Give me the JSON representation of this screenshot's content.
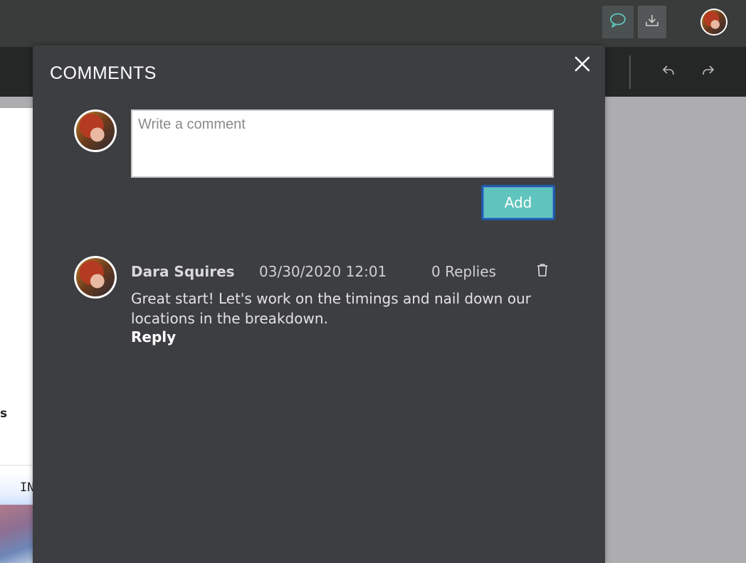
{
  "topbar": {
    "comments_icon": "speech-bubble-icon",
    "download_icon": "download-icon",
    "accent_color": "#5fc4bd"
  },
  "toolbar": {
    "undo_icon": "undo-icon",
    "redo_icon": "redo-icon"
  },
  "document": {
    "fragment_right_letter": "s",
    "fragment_bottom": "IN"
  },
  "comments_panel": {
    "title": "COMMENTS",
    "close_icon": "close-icon",
    "input": {
      "placeholder": "Write a comment",
      "value": ""
    },
    "add_label": "Add",
    "comments": [
      {
        "author": "Dara Squires",
        "date": "03/30/2020 12:01",
        "replies": "0 Replies",
        "body": "Great start! Let's work on the timings and nail down our locations in the breakdown.",
        "reply_label": "Reply",
        "delete_icon": "trash-icon"
      }
    ]
  }
}
